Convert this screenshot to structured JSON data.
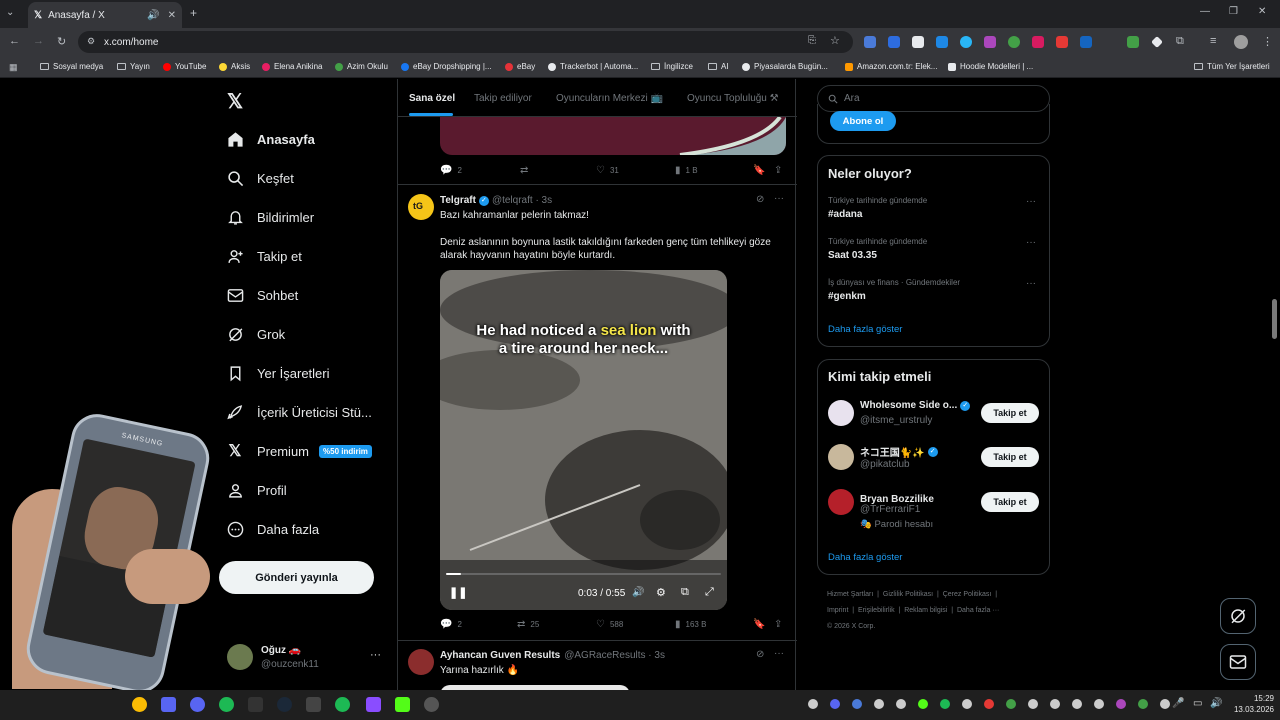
{
  "browser": {
    "tab_title": "Anasayfa / X",
    "url": "x.com/home",
    "bookmarks": [
      "Sosyal medya",
      "Yayın",
      "YouTube",
      "Aksis",
      "Elena Anikina",
      "Azim Okulu",
      "eBay Dropshipping |...",
      "eBay",
      "Trackerbot | Automa...",
      "İngilizce",
      "AI",
      "Piyasalarda Bugün...",
      "Amazon.com.tr: Elek...",
      "Hoodie Modelleri | ...",
      "Tüm Yer İşaretleri"
    ]
  },
  "sidebar": {
    "items": [
      {
        "label": "Anasayfa",
        "icon": "home-icon"
      },
      {
        "label": "Keşfet",
        "icon": "search-icon"
      },
      {
        "label": "Bildirimler",
        "icon": "bell-icon"
      },
      {
        "label": "Takip et",
        "icon": "person-add-icon"
      },
      {
        "label": "Sohbet",
        "icon": "mail-icon"
      },
      {
        "label": "Grok",
        "icon": "grok-icon"
      },
      {
        "label": "Yer İşaretleri",
        "icon": "bookmark-icon"
      },
      {
        "label": "İçerik Üreticisi Stü...",
        "icon": "rocket-icon"
      },
      {
        "label": "Premium",
        "icon": "x-logo-icon"
      },
      {
        "label": "Profil",
        "icon": "person-icon"
      },
      {
        "label": "Daha fazla",
        "icon": "more-circle-icon"
      }
    ],
    "premium_badge": "%50 indirim",
    "post_button": "Gönderi yayınla",
    "account": {
      "name": "Oğuz 🚗",
      "handle": "@ouzcenk11"
    }
  },
  "feed": {
    "tabs": [
      "Sana özel",
      "Takip ediliyor",
      "Oyuncuların Merkezi 📺",
      "Oyuncu Topluluğu ⚒"
    ],
    "prev_post_actions": {
      "replies": "2",
      "likes": "31",
      "views": "1 B"
    },
    "post": {
      "name": "Telgraft",
      "handle": "@telqraft · 3s",
      "line1": "Bazı kahramanlar pelerin takmaz!",
      "line2": "Deniz aslanının boynuna lastik takıldığını farkeden genç tüm tehlikeyi göze alarak hayvanın hayatını böyle kurtardı.",
      "caption_a": "He had noticed a ",
      "caption_b": "sea lion",
      "caption_c": " with",
      "caption_d": "a tire around her neck...",
      "video_time": "0:03 / 0:55",
      "video_progress": 0.055,
      "replies": "2",
      "reposts": "25",
      "likes": "588",
      "views": "163 B"
    },
    "next_post": {
      "name": "Ayhancan Guven Results",
      "handle": "@AGRaceResults · 3s",
      "text": "Yarına hazırlık 🔥"
    }
  },
  "right": {
    "search_placeholder": "Ara",
    "subscribe_button": "Abone ol",
    "trends_title": "Neler oluyor?",
    "trends": [
      {
        "meta": "Türkiye tarihinde gündemde",
        "name": "#adana"
      },
      {
        "meta": "Türkiye tarihinde gündemde",
        "name": "Saat 03.35"
      },
      {
        "meta": "İş dünyası ve finans · Gündemdekiler",
        "name": "#genkm"
      }
    ],
    "show_more": "Daha fazla göster",
    "who_title": "Kimi takip etmeli",
    "who": [
      {
        "name": "Wholesome Side o...",
        "handle": "@itsme_urstruly",
        "extra": ""
      },
      {
        "name": "ネコ王国🐈✨",
        "handle": "@pikatclub",
        "extra": ""
      },
      {
        "name": "Bryan Bozzilike",
        "handle": "@TrFerrariF1",
        "extra": "🎭 Parodi hesabı"
      }
    ],
    "follow_label": "Takip et",
    "footer": [
      "Hizmet Şartları",
      "Gizlilik Politikası",
      "Çerez Politikası",
      "Imprint",
      "Erişilebilirlik",
      "Reklam bilgisi",
      "Daha fazla ···",
      "© 2026 X Corp."
    ]
  },
  "taskbar": {
    "time": "15:29",
    "date": "13.03.2026"
  }
}
